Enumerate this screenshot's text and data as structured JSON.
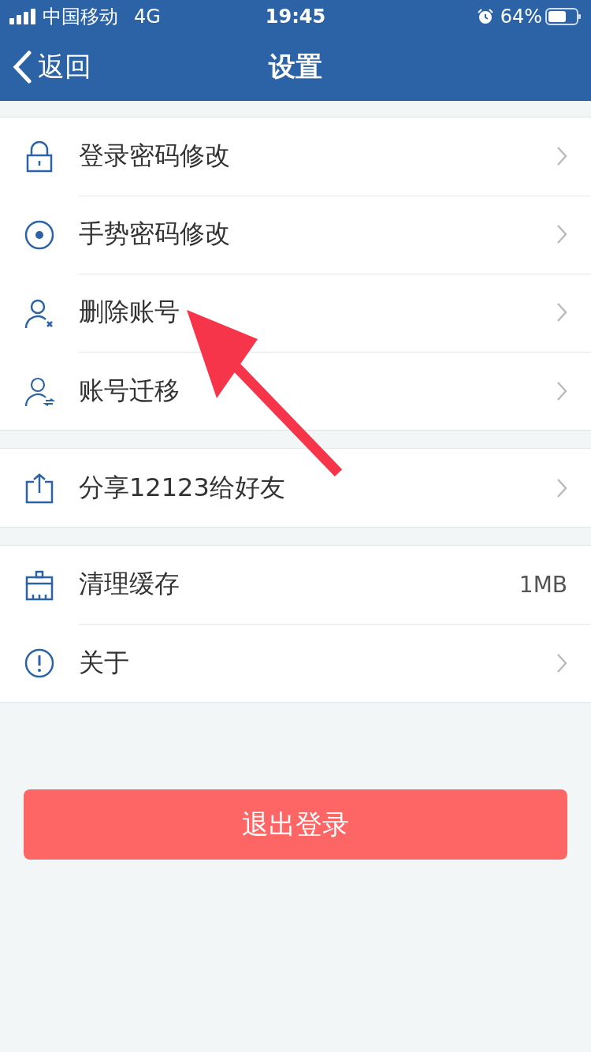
{
  "status_bar": {
    "carrier": "中国移动",
    "network": "4G",
    "time": "19:45",
    "battery": "64%"
  },
  "nav": {
    "back": "返回",
    "title": "设置"
  },
  "sections": [
    {
      "items": [
        {
          "label": "登录密码修改",
          "kind": "link"
        },
        {
          "label": "手势密码修改",
          "kind": "link"
        },
        {
          "label": "删除账号",
          "kind": "link"
        },
        {
          "label": "账号迁移",
          "kind": "link"
        }
      ]
    },
    {
      "items": [
        {
          "label": "分享12123给好友",
          "kind": "link"
        }
      ]
    },
    {
      "items": [
        {
          "label": "清理缓存",
          "kind": "value",
          "value": "1MB"
        },
        {
          "label": "关于",
          "kind": "link"
        }
      ]
    }
  ],
  "logout_button": "退出登录"
}
